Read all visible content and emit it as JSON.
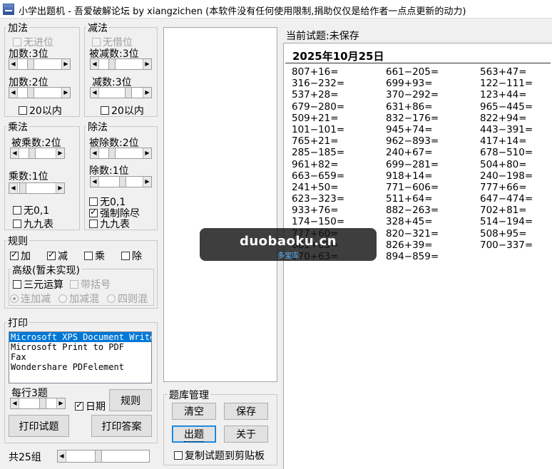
{
  "window": {
    "title": "小学出题机 - 吾爱破解论坛 by xiangzichen (本软件没有任何使用限制,捐助仅仅是给作者一点点更新的动力)"
  },
  "addition": {
    "title": "加法",
    "no_carry": "无进位",
    "addend1": "加数:3位",
    "addend2": "加数:2位",
    "within20": "20以内"
  },
  "subtraction": {
    "title": "减法",
    "no_borrow": "无借位",
    "minuend": "被减数:3位",
    "subtrahend": "减数:3位",
    "within20": "20以内"
  },
  "multiplication": {
    "title": "乘法",
    "multiplicand": "被乘数:2位",
    "multiplier": "乘数:1位",
    "no_zero_one": "无0,1",
    "times_table": "九九表"
  },
  "division": {
    "title": "除法",
    "dividend": "被除数:2位",
    "divisor": "除数:1位",
    "no_zero_one": "无0,1",
    "force_exact": "强制除尽",
    "times_table": "九九表"
  },
  "rules": {
    "title": "规则",
    "add": "加",
    "sub": "减",
    "mul": "乘",
    "div": "除",
    "advanced_title": "高级(暂未实现)",
    "ternary": "三元运算",
    "brackets": "带括号",
    "chain_add_sub": "连加减",
    "mixed_add_sub": "加减混",
    "four_ops_mixed": "四则混"
  },
  "print": {
    "title": "打印",
    "printers": [
      "Microsoft XPS Document Writer",
      "Microsoft Print to PDF",
      "Fax",
      "Wondershare PDFelement"
    ],
    "per_row": "每行3题",
    "date": "日期",
    "rules_button": "规则",
    "print_questions": "打印试题",
    "print_answers": "打印答案"
  },
  "footer": {
    "groups": "共25组"
  },
  "bank": {
    "title": "题库管理",
    "clear": "清空",
    "save": "保存",
    "generate": "出题",
    "about": "关于",
    "copy_to_clipboard": "复制试题到剪贴板"
  },
  "current": {
    "status": "当前试题:未保存",
    "date": "2025年10月25日",
    "columns": [
      [
        "807+16=",
        "316−232=",
        "537+28=",
        "679−280=",
        "509+21=",
        "101−101=",
        "765+21=",
        "285−185=",
        "961+82=",
        "663−659=",
        "241+50=",
        "623−323=",
        "933+76=",
        "174−150=",
        "777+60=",
        "681+83=",
        "870+63="
      ],
      [
        "661−205=",
        "699+93=",
        "370−292=",
        "631+86=",
        "832−176=",
        "945+74=",
        "962−893=",
        "240+67=",
        "699−281=",
        "918+14=",
        "771−606=",
        "511+64=",
        "882−263=",
        "328+45=",
        "820−321=",
        "826+39=",
        "894−859="
      ],
      [
        "563+47=",
        "122−111=",
        "123+44=",
        "965−445=",
        "822+94=",
        "443−391=",
        "417+14=",
        "678−510=",
        "504+80=",
        "240−198=",
        "777+66=",
        "647−474=",
        "702+81=",
        "514−194=",
        "508+95=",
        "700−337="
      ]
    ]
  },
  "watermark": {
    "main": "duobaoku.cn",
    "sub": "多宝库"
  }
}
